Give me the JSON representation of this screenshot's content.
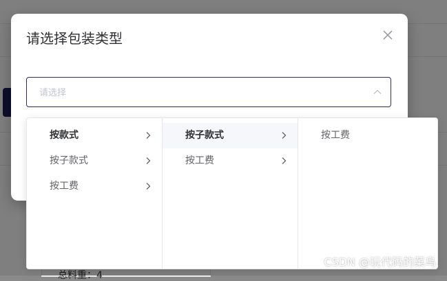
{
  "background": {
    "weight_text": "总料重：4"
  },
  "dialog": {
    "title": "请选择包装类型",
    "input_placeholder": "请选择"
  },
  "cascader": {
    "column1": [
      {
        "label": "按款式",
        "active": true
      },
      {
        "label": "按子款式",
        "active": false
      },
      {
        "label": "按工费",
        "active": false
      }
    ],
    "column2": [
      {
        "label": "按子款式",
        "active": true
      },
      {
        "label": "按工费",
        "active": false
      }
    ],
    "column3": [
      {
        "label": "按工费"
      }
    ]
  },
  "watermark": "CSDN @玩代码的菜鸟",
  "colors": {
    "input_border": "#2d2a66",
    "highlight_bg": "#f5f7fa"
  },
  "icons": {
    "close": "close-icon",
    "chevron_up": "chevron-up-icon",
    "chevron_right": "chevron-right-icon"
  }
}
